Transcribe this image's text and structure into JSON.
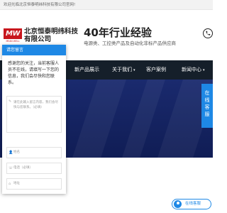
{
  "topbar": {
    "welcome": "欢迎光临北京恒泰明纬科技有限公司官网!"
  },
  "logo": {
    "mark": "MW",
    "subtext": "MEAN WELL"
  },
  "header": {
    "company_name": "北京恒泰明纬科技有限公司",
    "slogan_title": "40年行业经验",
    "slogan_sub": "电源类、工控类产品及自动化非标产品供应商",
    "phone_icon": "phone-icon"
  },
  "nav": {
    "items": [
      {
        "label": "新产品展示",
        "active": false,
        "dropdown": false
      },
      {
        "label": "关于我们",
        "active": false,
        "dropdown": true
      },
      {
        "label": "客户案例",
        "active": false,
        "dropdown": false
      },
      {
        "label": "新闻中心",
        "active": false,
        "dropdown": true
      }
    ],
    "caret": "▾"
  },
  "chat": {
    "title": "请您留言",
    "message": "感谢您的关注，当前客服人员不在线，请填写一下您的信息，我们会尽快和您联系。",
    "fields": [
      {
        "icon": "edit-icon",
        "placeholder": "请在此输入留言内容，我们会尽快与您联系。（必填）"
      },
      {
        "icon": "user-icon",
        "placeholder": "姓名"
      },
      {
        "icon": "phone-icon",
        "placeholder": "电话（必填）"
      },
      {
        "icon": "location-icon",
        "placeholder": "地址"
      }
    ]
  },
  "side_service": {
    "label": "在线客服"
  },
  "online_button": {
    "label": "在线客服"
  },
  "colors": {
    "nav_bg": "#151f2a",
    "nav_active": "#1f3a8a",
    "accent_blue": "#1e88e5",
    "logo_red": "#c8161d",
    "banner_bg": "#1a2a6e"
  }
}
